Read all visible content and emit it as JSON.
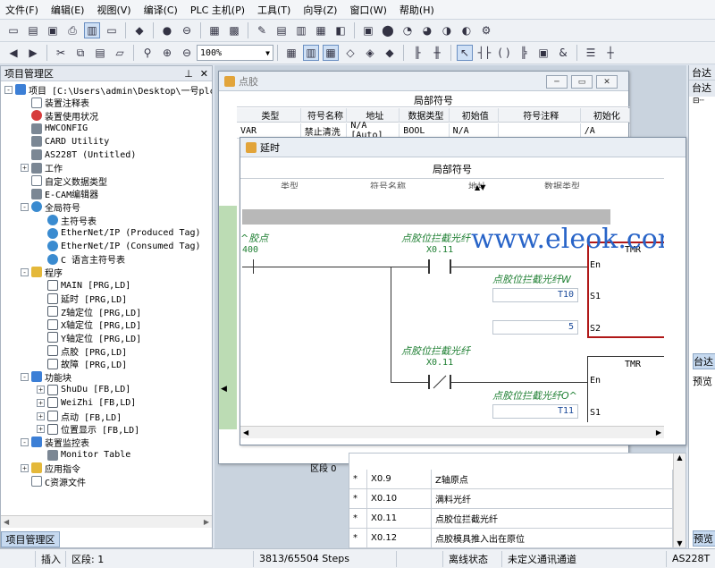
{
  "menu": [
    "文件(F)",
    "编辑(E)",
    "视图(V)",
    "编译(C)",
    "PLC 主机(P)",
    "工具(T)",
    "向导(Z)",
    "窗口(W)",
    "帮助(H)"
  ],
  "toolbar": {
    "zoom_value": "100%",
    "zoom_arrow": "▼",
    "amp_label": "&"
  },
  "project_panel": {
    "title": "项目管理区",
    "pin_icon": "pin-icon",
    "tab_label": "项目管理区",
    "tree": [
      {
        "label": "项目 [C:\\Users\\admin\\Desktop\\一号plc",
        "level": 0,
        "exp": "-",
        "icon": "blue"
      },
      {
        "label": "装置注释表",
        "level": 1,
        "exp": "",
        "icon": "doc"
      },
      {
        "label": "装置使用状况",
        "level": 1,
        "exp": "",
        "icon": "red"
      },
      {
        "label": "HWCONFIG",
        "level": 1,
        "exp": "",
        "icon": "gray"
      },
      {
        "label": "CARD Utility",
        "level": 1,
        "exp": "",
        "icon": "gray"
      },
      {
        "label": "AS228T  (Untitled)",
        "level": 1,
        "exp": "",
        "icon": "gray"
      },
      {
        "label": "工作",
        "level": 1,
        "exp": "+",
        "icon": "gray"
      },
      {
        "label": "自定义数据类型",
        "level": 1,
        "exp": "",
        "icon": "doc"
      },
      {
        "label": "E-CAM编辑器",
        "level": 1,
        "exp": "",
        "icon": "gray"
      },
      {
        "label": "全局符号",
        "level": 1,
        "exp": "-",
        "icon": "globe"
      },
      {
        "label": "主符号表",
        "level": 2,
        "exp": "",
        "icon": "globe"
      },
      {
        "label": "EtherNet/IP (Produced Tag)",
        "level": 2,
        "exp": "",
        "icon": "globe"
      },
      {
        "label": "EtherNet/IP (Consumed Tag)",
        "level": 2,
        "exp": "",
        "icon": "globe"
      },
      {
        "label": "C 语言主符号表",
        "level": 2,
        "exp": "",
        "icon": "globe"
      },
      {
        "label": "程序",
        "level": 1,
        "exp": "-",
        "icon": "yellow"
      },
      {
        "label": "MAIN [PRG,LD]",
        "level": 2,
        "exp": "",
        "icon": "prog"
      },
      {
        "label": "延时 [PRG,LD]",
        "level": 2,
        "exp": "",
        "icon": "prog"
      },
      {
        "label": "Z轴定位 [PRG,LD]",
        "level": 2,
        "exp": "",
        "icon": "prog"
      },
      {
        "label": "X轴定位 [PRG,LD]",
        "level": 2,
        "exp": "",
        "icon": "prog"
      },
      {
        "label": "Y轴定位 [PRG,LD]",
        "level": 2,
        "exp": "",
        "icon": "prog"
      },
      {
        "label": "点胶 [PRG,LD]",
        "level": 2,
        "exp": "",
        "icon": "prog"
      },
      {
        "label": "故障 [PRG,LD]",
        "level": 2,
        "exp": "",
        "icon": "prog"
      },
      {
        "label": "功能块",
        "level": 1,
        "exp": "-",
        "icon": "blue"
      },
      {
        "label": "ShuDu [FB,LD]",
        "level": 2,
        "exp": "+",
        "icon": "prog"
      },
      {
        "label": "WeiZhi [FB,LD]",
        "level": 2,
        "exp": "+",
        "icon": "prog"
      },
      {
        "label": "点动 [FB,LD]",
        "level": 2,
        "exp": "+",
        "icon": "prog"
      },
      {
        "label": "位置显示 [FB,LD]",
        "level": 2,
        "exp": "+",
        "icon": "prog"
      },
      {
        "label": "装置监控表",
        "level": 1,
        "exp": "-",
        "icon": "blue"
      },
      {
        "label": "Monitor Table",
        "level": 2,
        "exp": "",
        "icon": "gray"
      },
      {
        "label": "应用指令",
        "level": 1,
        "exp": "+",
        "icon": "yellow"
      },
      {
        "label": "C资源文件",
        "level": 1,
        "exp": "",
        "icon": "doc"
      }
    ]
  },
  "window_dianjiao": {
    "title": "点胶",
    "local_symbols": "局部符号",
    "columns": [
      "类型",
      "符号名称",
      "地址",
      "数据类型",
      "初始值",
      "符号注释",
      "初始化"
    ],
    "row": [
      "VAR",
      "禁止清洗",
      "N/A [Auto]",
      "BOOL",
      "N/A",
      "",
      "/A"
    ]
  },
  "window_yanshi": {
    "title": "延时",
    "local_symbols": "局部符号",
    "columns_partial": [
      "类型",
      "符号名称",
      "地址",
      "数据类型"
    ],
    "rung1": {
      "label_left": "^胶点",
      "addr_left": "400",
      "contact_label": "点胶位拦截光纤",
      "contact_addr": "X0.11",
      "tmr": "TMR",
      "en": "En",
      "s1": "S1",
      "s2": "S2",
      "s1_label": "点胶位拦截光纤W",
      "s1_value": "T10",
      "s2_value": "5"
    },
    "rung2": {
      "contact_label": "点胶位拦截光纤",
      "contact_addr": "X0.11",
      "tmr": "TMR",
      "en": "En",
      "s1": "S1",
      "s1_label": "点胶位拦截光纤O^",
      "s1_value": "T11"
    }
  },
  "watermark": "www.eleok.com",
  "bottom_table": {
    "tab_label": "区段 0",
    "rows": [
      {
        "mark": "*",
        "addr": "X0.9",
        "comment": "Z轴原点"
      },
      {
        "mark": "*",
        "addr": "X0.10",
        "comment": "满料光纤"
      },
      {
        "mark": "*",
        "addr": "X0.11",
        "comment": "点胶位拦截光纤"
      },
      {
        "mark": "*",
        "addr": "X0.12",
        "comment": "点胶模具推入出在原位"
      }
    ]
  },
  "right_panel": {
    "title": "台达",
    "subtitle": "台达",
    "tab1": "台达",
    "tab2": "预览",
    "tab3": "预览"
  },
  "status": {
    "mode": "插入",
    "section": "区段: 1",
    "steps": "3813/65504 Steps",
    "online": "离线状态",
    "channel": "未定义通讯通道",
    "model": "AS228T"
  }
}
